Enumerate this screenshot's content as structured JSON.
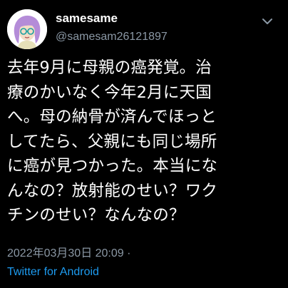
{
  "tweet": {
    "display_name": "samesame",
    "handle": "@samesam26121897",
    "text": "去年9月に母親の癌発覚。治\n療のかいなく今年2月に天国\nへ。母の納骨が済んでほっと\nしてたら、父親にも同じ場所\nに癌が見つかった。本当にな\nんなの？放射能のせい？ワク\nチンのせい？なんなの？",
    "timestamp": "2022年03月30日 20:09 ·",
    "source": "Twitter for Android",
    "more_icon": "chevron-down-icon",
    "avatar_icon": "avatar-illustration"
  },
  "colors": {
    "background": "#000000",
    "text": "#ffffff",
    "muted": "#8b98a5",
    "link": "#1d9bf0",
    "avatar_hair": "#b48cd8"
  }
}
